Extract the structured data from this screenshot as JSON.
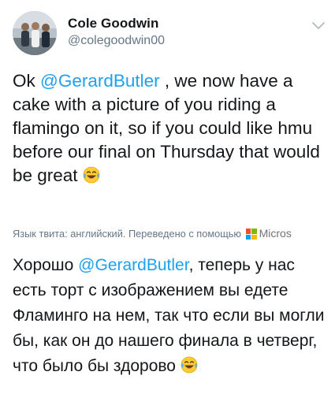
{
  "user": {
    "display_name": "Cole Goodwin",
    "handle": "@colegoodwin00"
  },
  "tweet": {
    "original": {
      "prefix": "Ok ",
      "mention": "@GerardButler",
      "text": " , we now have a cake with a picture of you riding a flamingo on it, so if you could like hmu before our final on Thursday that would be great"
    },
    "translation_label": "Язык твита: английский. Переведено с помощью",
    "translation_provider": "Micros",
    "translated": {
      "prefix": "Хорошо ",
      "mention": "@GerardButler",
      "text": ", теперь у нас есть торт с изображением вы едете Фламинго на нем, так что если вы могли бы, как он до нашего финала в четверг, что было бы здорово"
    }
  },
  "icons": {
    "caret": "chevron-down-icon",
    "emoji": "face-with-tears-of-joy-emoji",
    "provider_logo": "microsoft-logo-icon"
  },
  "colors": {
    "mention": "#1da1f2",
    "secondary_text": "#657786",
    "primary_text": "#14171a"
  }
}
